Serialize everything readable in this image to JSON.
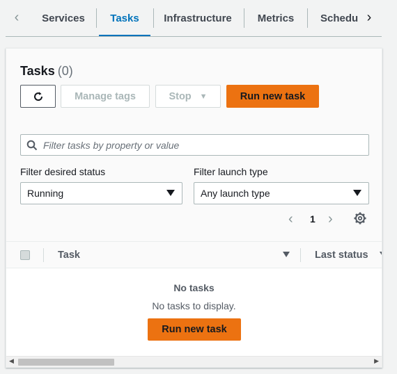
{
  "tabs": [
    {
      "label": "Services"
    },
    {
      "label": "Tasks"
    },
    {
      "label": "Infrastructure"
    },
    {
      "label": "Metrics"
    },
    {
      "label": "Scheduled tasks"
    }
  ],
  "panel": {
    "title": "Tasks",
    "count": "(0)",
    "buttons": {
      "manage_tags": "Manage tags",
      "stop": "Stop",
      "run_new_task": "Run new task"
    },
    "search": {
      "placeholder": "Filter tasks by property or value"
    },
    "filters": {
      "desired_status": {
        "label": "Filter desired status",
        "value": "Running"
      },
      "launch_type": {
        "label": "Filter launch type",
        "value": "Any launch type"
      }
    },
    "pagination": {
      "current_page": "1"
    }
  },
  "table": {
    "columns": [
      "Task",
      "Last status"
    ],
    "empty": {
      "title": "No tasks",
      "message": "No tasks to display.",
      "button": "Run new task"
    }
  },
  "colors": {
    "accent": "#0073bb",
    "primary_button": "#ec7211"
  },
  "icons": [
    "chevron-left-icon",
    "chevron-right-icon",
    "refresh-icon",
    "caret-down-icon",
    "search-icon",
    "settings-gear-icon",
    "sort-icon"
  ]
}
